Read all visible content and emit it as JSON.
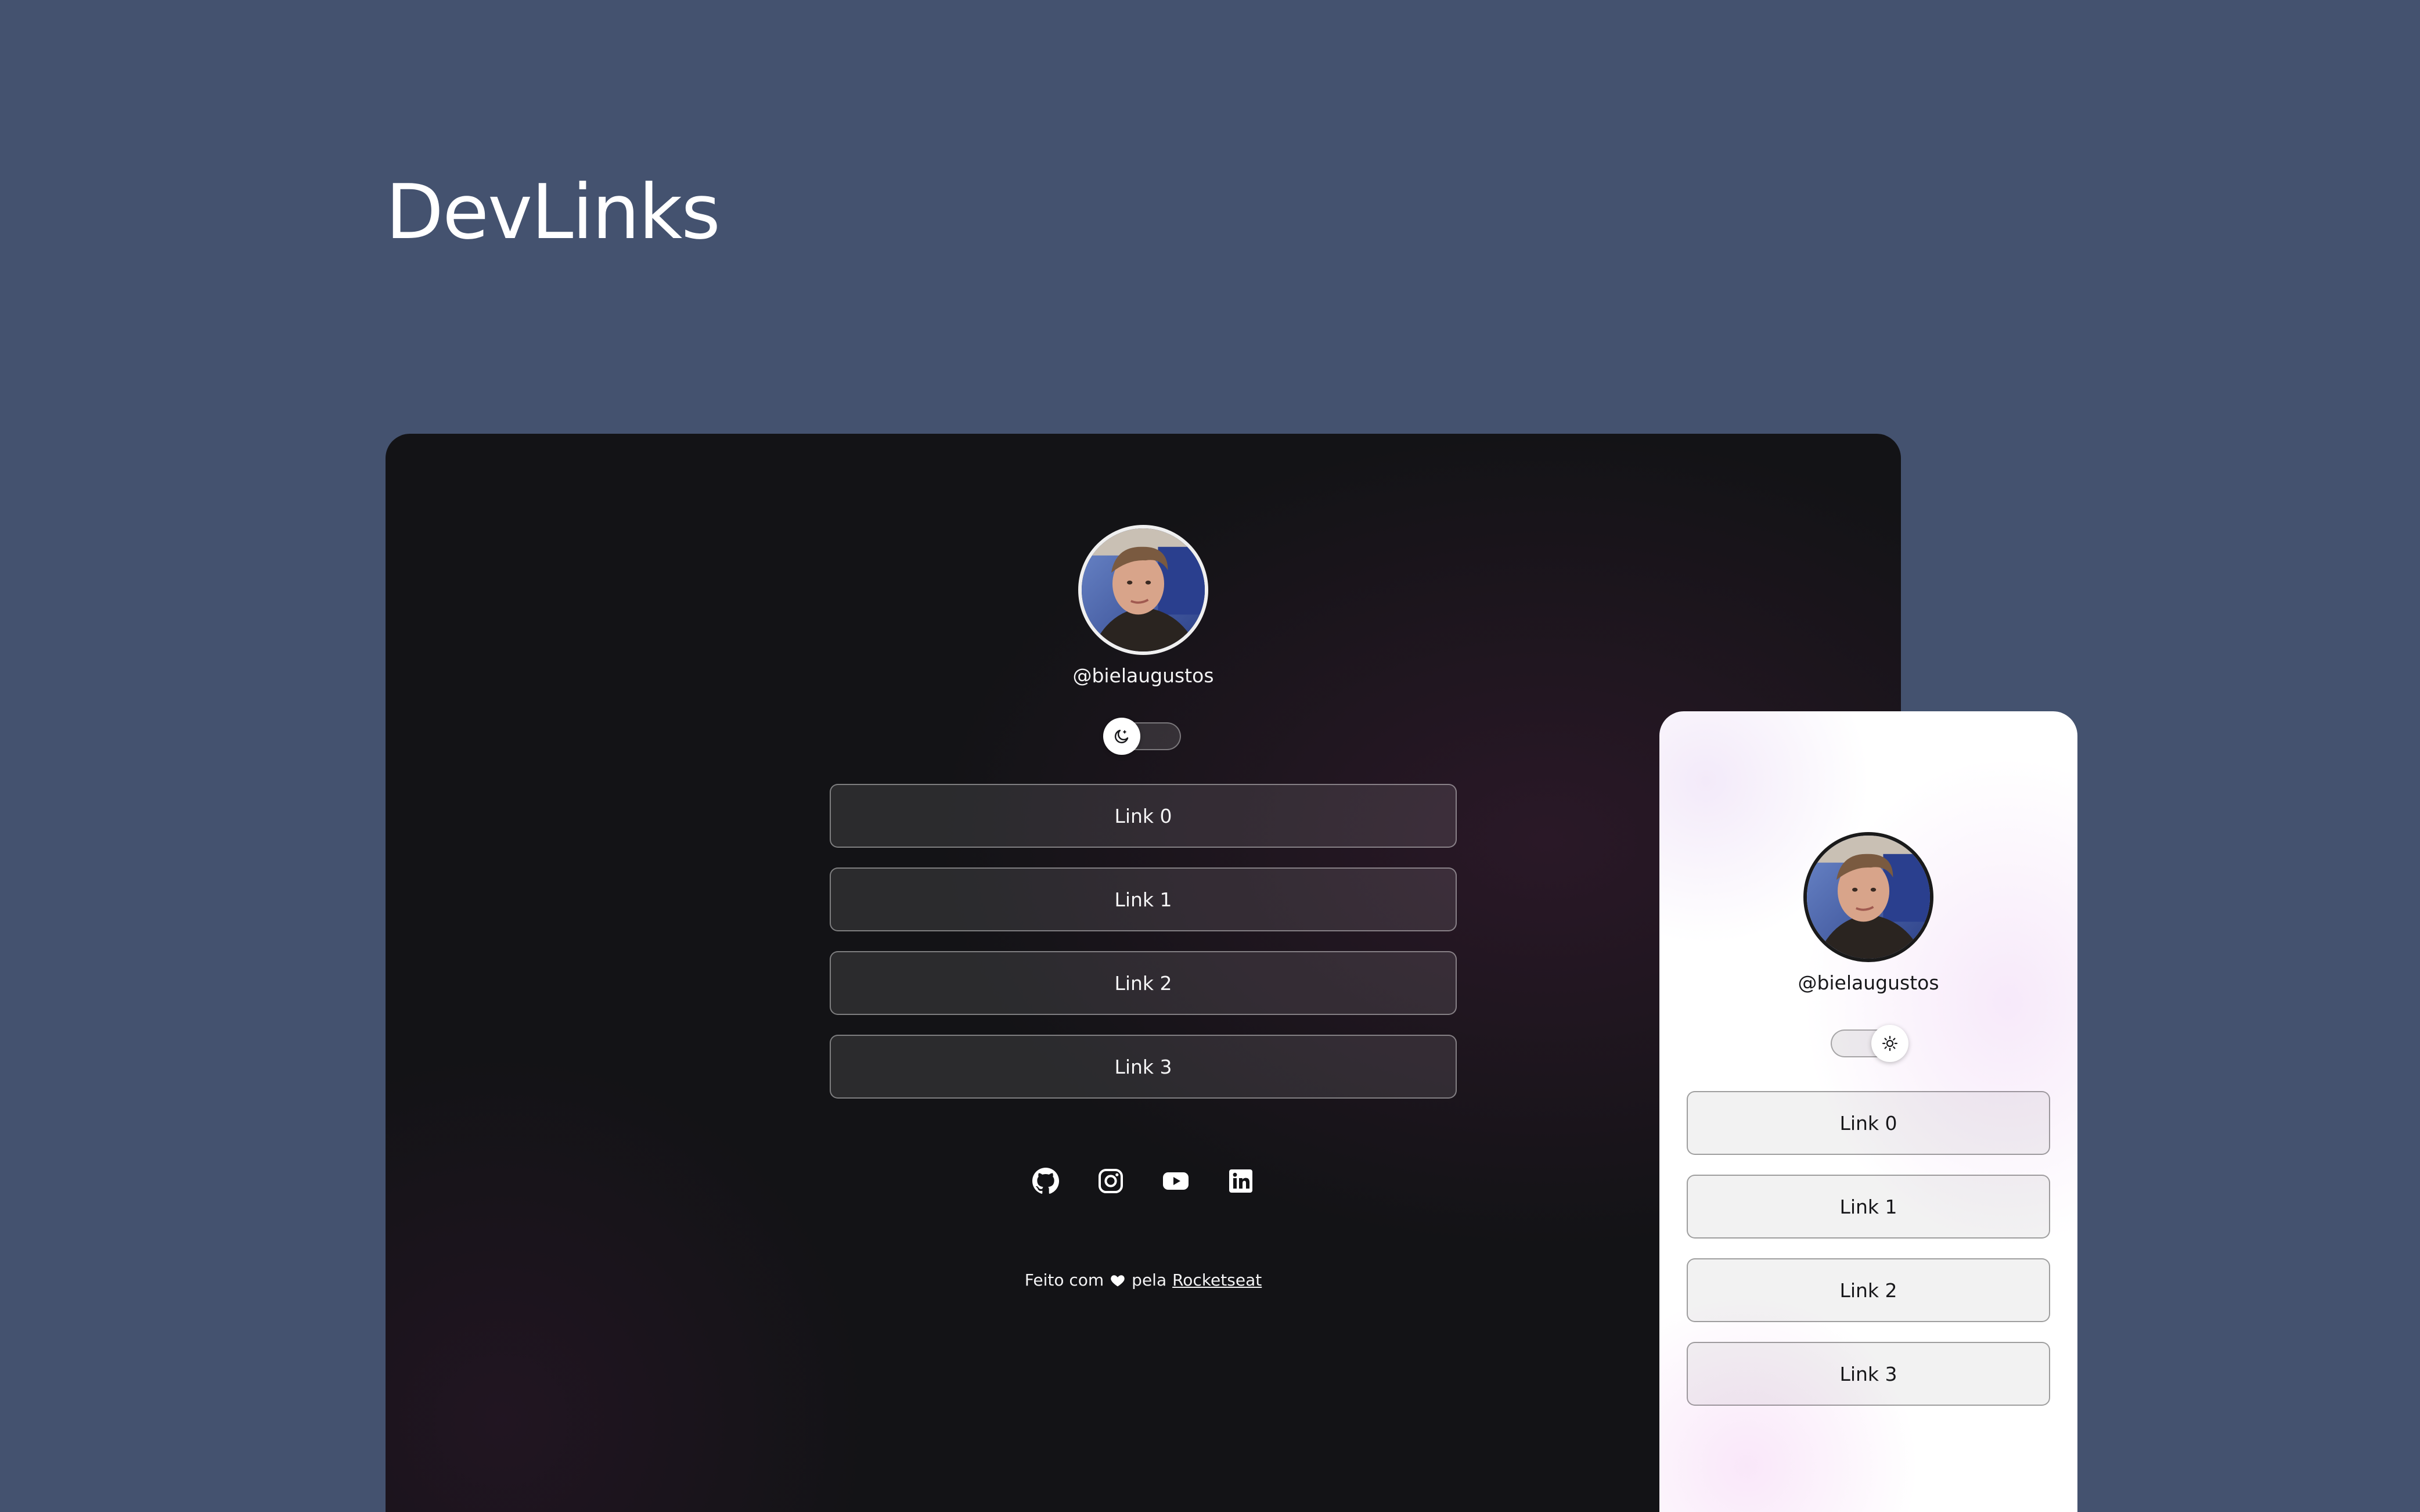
{
  "header": {
    "title": "DevLinks"
  },
  "dark_preview": {
    "username": "@bielaugustos",
    "theme_switch": {
      "state": "dark",
      "icon": "moon-icon"
    },
    "links": [
      {
        "label": "Link 0"
      },
      {
        "label": "Link 1"
      },
      {
        "label": "Link 2"
      },
      {
        "label": "Link 3"
      }
    ],
    "social_icons": [
      "github-icon",
      "instagram-icon",
      "youtube-icon",
      "linkedin-icon"
    ],
    "footer": {
      "text_before": "Feito com",
      "text_after": "pela",
      "link_label": "Rocketseat"
    }
  },
  "light_preview": {
    "username": "@bielaugustos",
    "theme_switch": {
      "state": "light",
      "icon": "sun-icon"
    },
    "links": [
      {
        "label": "Link 0"
      },
      {
        "label": "Link 1"
      },
      {
        "label": "Link 2"
      },
      {
        "label": "Link 3"
      }
    ]
  },
  "colors": {
    "page_background": "#44526f",
    "dark_card_background": "#131316",
    "light_card_background": "#ffffff",
    "text_light": "#f4f4f5",
    "text_dark": "#18181b"
  }
}
